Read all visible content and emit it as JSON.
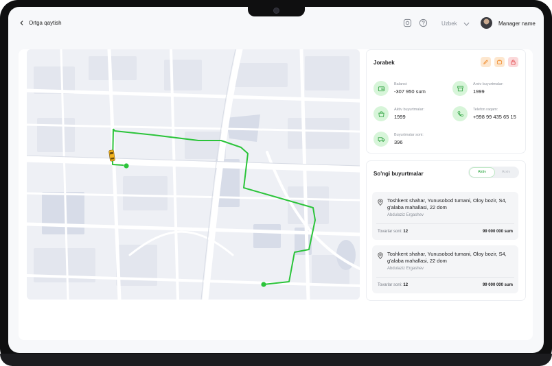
{
  "header": {
    "back_label": "Ortga qaytish",
    "language": "Uzbek",
    "user_name": "Manager name"
  },
  "driver": {
    "name": "Jorabek",
    "stats": [
      {
        "label": "Balansi:",
        "value": "-307 950 sum",
        "icon": "wallet-icon"
      },
      {
        "label": "Arxiv buyurtmalar:",
        "value": "1999",
        "icon": "archive-box-icon"
      },
      {
        "label": "Aktiv buyurtmalar:",
        "value": "1999",
        "icon": "shopping-bag-icon"
      },
      {
        "label": "Telefon raqam:",
        "value": "+998 99 435 65 15",
        "icon": "phone-icon"
      },
      {
        "label": "Buyurtmalar soni:",
        "value": "396",
        "icon": "truck-icon"
      }
    ]
  },
  "orders": {
    "title": "So'ngi buyurtmalar",
    "tabs": [
      "Aktiv",
      "Arxiv"
    ],
    "active_tab": "Aktiv",
    "list": [
      {
        "address": "Toshkent shahar, Yunusobod tumani, Oloy bozir, S4, g'alaba mahallasi, 22 dom",
        "customer": "Abdulaziz Ergashev",
        "items_label": "Tovarlar soni:",
        "items_count": "12",
        "price": "99 000 000 sum"
      },
      {
        "address": "Toshkent shahar, Yunusobod tumani, Oloy bozir, S4, g'alaba mahallasi, 22 dom",
        "customer": "Abdulaziz Ergashev",
        "items_label": "Tovarlar soni:",
        "items_count": "12",
        "price": "99 000 000 sum"
      }
    ]
  },
  "colors": {
    "accent_green": "#2bc43a",
    "icon_bg": "#d7f5d9",
    "edit_bg": "#fde7cf",
    "delete_bg": "#fbd9da"
  }
}
